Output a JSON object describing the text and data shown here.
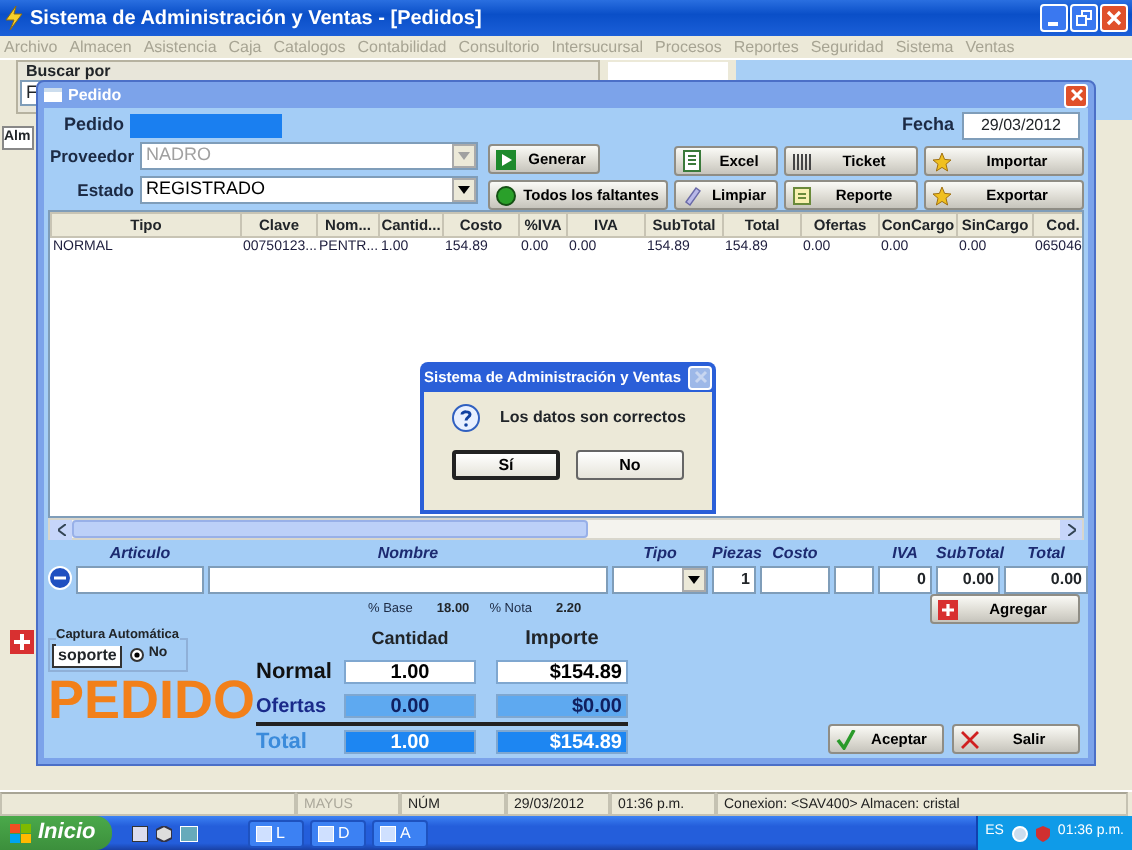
{
  "window": {
    "title": "Sistema de  Administración y Ventas - [Pedidos]"
  },
  "menu": [
    {
      "label": "Archivo",
      "disabled": true
    },
    {
      "label": "Almacen",
      "disabled": true
    },
    {
      "label": "Asistencia",
      "disabled": true
    },
    {
      "label": "Caja",
      "disabled": true
    },
    {
      "label": "Catalogos",
      "disabled": true
    },
    {
      "label": "Contabilidad",
      "disabled": true
    },
    {
      "label": "Consultorio",
      "disabled": true
    },
    {
      "label": "Intersucursal",
      "disabled": true
    },
    {
      "label": "Procesos",
      "disabled": true
    },
    {
      "label": "Reportes",
      "disabled": true
    },
    {
      "label": "Seguridad",
      "disabled": true
    },
    {
      "label": "Sistema",
      "disabled": true
    },
    {
      "label": "Ventas",
      "disabled": true
    }
  ],
  "search_panel": {
    "title": "Buscar por",
    "field_value": "F"
  },
  "side_tab": {
    "label": "Alm"
  },
  "pedido": {
    "title": "Pedido",
    "pedido_label": "Pedido",
    "fecha_label": "Fecha",
    "fecha": "29/03/2012",
    "proveedor": {
      "label": "Proveedor",
      "value": "NADRO",
      "disabled": true
    },
    "estado": {
      "label": "Estado",
      "value": "REGISTRADO",
      "disabled": false
    },
    "actions": [
      "Generar",
      "Todos los faltantes"
    ],
    "tools": [
      "Excel",
      "Ticket",
      "Importar",
      "Limpiar",
      "Reporte",
      "Exportar"
    ],
    "table": {
      "columns": [
        "Tipo",
        "Clave",
        "Nom...",
        "Cantid...",
        "Costo",
        "%IVA",
        "IVA",
        "SubTotal",
        "Total",
        "Ofertas",
        "ConCargo",
        "SinCargo",
        "Cod."
      ],
      "rows": [
        [
          "NORMAL",
          "00750123...",
          "PENTR...",
          "1.00",
          "154.89",
          "0.00",
          "0.00",
          "154.89",
          "154.89",
          "0.00",
          "0.00",
          "0.00",
          "065046"
        ]
      ]
    },
    "entry": [
      {
        "kind": "field",
        "label": "Articulo"
      },
      {
        "kind": "field",
        "label": "Nombre"
      },
      {
        "kind": "combo",
        "label": "Tipo"
      },
      {
        "kind": "field",
        "label": "Piezas",
        "value": "1"
      },
      {
        "kind": "field",
        "label": "Costo"
      },
      {
        "kind": "field"
      },
      {
        "kind": "field",
        "label": "IVA",
        "value": "0"
      },
      {
        "kind": "field",
        "label": "SubTotal",
        "value": "0.00"
      },
      {
        "kind": "field",
        "label": "Total",
        "value": "0.00"
      }
    ],
    "base_label": "% Base",
    "base": "18.00",
    "nota_label": "% Nota",
    "nota": "2.20",
    "add_button": "Agregar",
    "captura": {
      "title": "Captura Automática",
      "field": "soporte",
      "option": "No",
      "checked": true
    },
    "big_label": "PEDIDO",
    "totals": {
      "headers": [
        "Cantidad",
        "Importe"
      ],
      "rows": [
        {
          "kind": "normal",
          "label": "Normal",
          "cantidad": "1.00",
          "importe": "$154.89"
        },
        {
          "kind": "offer",
          "label": "Ofertas",
          "cantidad": "0.00",
          "importe": "$0.00"
        },
        {
          "kind": "total",
          "label": "Total",
          "cantidad": "1.00",
          "importe": "$154.89"
        }
      ]
    },
    "buttons": [
      "Aceptar",
      "Salir"
    ]
  },
  "message": {
    "title": "Sistema de Administración y Ventas",
    "text": "Los datos son correctos",
    "buttons": [
      {
        "label": "Sí",
        "focused": true
      },
      {
        "label": "No",
        "focused": false
      }
    ]
  },
  "status_bar": [
    {
      "text": "MAYUS",
      "disabled": true
    },
    {
      "text": "NÚM",
      "disabled": false
    },
    {
      "text": "29/03/2012",
      "disabled": false
    },
    {
      "text": "01:36 p.m.",
      "disabled": false
    },
    {
      "text": "Conexion: <SAV400> Almacen: cristal",
      "disabled": false
    }
  ],
  "taskbar": {
    "start": "Inicio",
    "tasks": [
      "L",
      "D",
      "A"
    ],
    "language": "ES",
    "clock": "01:36 p.m."
  }
}
